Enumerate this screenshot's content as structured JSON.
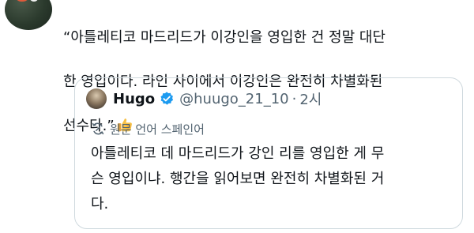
{
  "tweet": {
    "lines": [
      "“아틀레티코 마드리드가 이강인을 영입한 건 정말 대단",
      "한 영입이다. 라인 사이에서 이강인은 완전히 차별화된",
      "선수다.”"
    ],
    "emoji_icon": "thumbs-up-icon"
  },
  "quote": {
    "author_name": "Hugo",
    "handle": "@huugo_21_10",
    "separator": "·",
    "time": "2시",
    "verified_icon": "verified-badge-icon",
    "translate_label": "원문 언어 스페인어",
    "translate_icon": "translate-icon",
    "lines": [
      "아틀레티코 데 마드리드가 강인 리를 영입한 게 무",
      "슨 영입이냐. 행간을 읽어보면 완전히 차별화된 거",
      "다."
    ]
  },
  "colors": {
    "text": "#0f1419",
    "muted": "#536471",
    "border": "#cfd9de",
    "verified": "#1d9bf0"
  }
}
